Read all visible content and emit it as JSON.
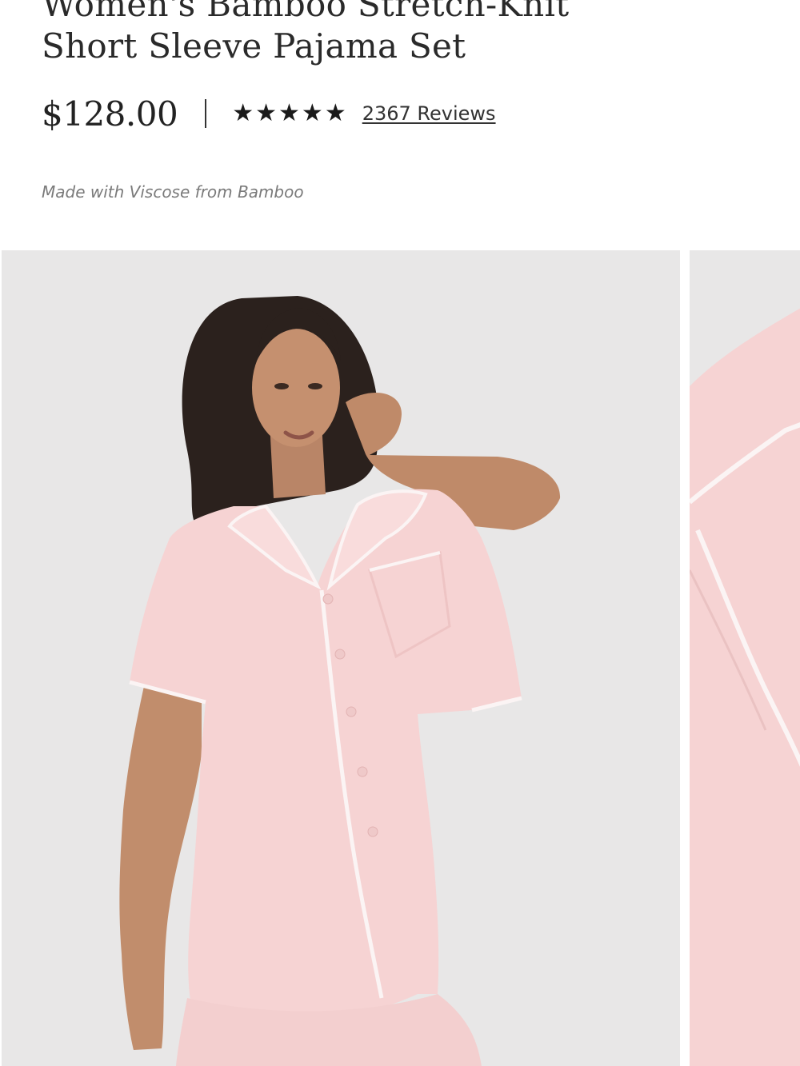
{
  "product": {
    "title_line_1": "Women's Bamboo Stretch-Knit",
    "title_line_2": "Short Sleeve Pajama Set",
    "price": "$128.00",
    "rating": {
      "stars": 5,
      "out_of": 5,
      "icon": "star-icon"
    },
    "reviews_label": "2367 Reviews",
    "material_note": "Made with Viscose from Bamboo"
  },
  "gallery": {
    "slides": [
      {
        "name": "model-front-view",
        "status": "current"
      },
      {
        "name": "collar-detail-closeup",
        "status": "next-partial"
      }
    ]
  },
  "colors": {
    "text_primary": "#222222",
    "text_muted": "#7a7a7a",
    "photo_background": "#e8e7e7",
    "garment_pink": "#f6d3d3",
    "piping_white": "#fbf4f4"
  }
}
